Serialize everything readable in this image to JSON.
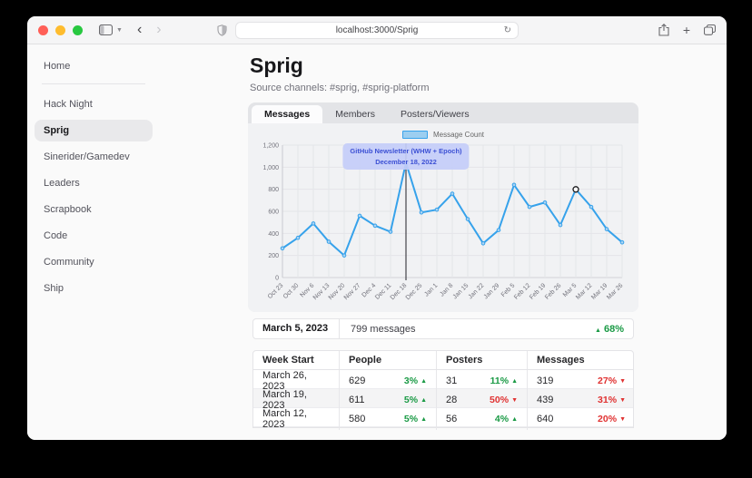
{
  "browser": {
    "url": "localhost:3000/Sprig",
    "traffic_lights": {
      "close": "#ff5f57",
      "minimize": "#febc2e",
      "zoom": "#28c840"
    }
  },
  "sidebar": {
    "items": [
      {
        "label": "Home"
      },
      {
        "label": "Hack Night"
      },
      {
        "label": "Sprig",
        "active": true
      },
      {
        "label": "Sinerider/Gamedev"
      },
      {
        "label": "Leaders"
      },
      {
        "label": "Scrapbook"
      },
      {
        "label": "Code"
      },
      {
        "label": "Community"
      },
      {
        "label": "Ship"
      }
    ]
  },
  "main": {
    "title": "Sprig",
    "subtitle": "Source channels: #sprig, #sprig-platform",
    "tabs": [
      {
        "label": "Messages",
        "active": true
      },
      {
        "label": "Members"
      },
      {
        "label": "Posters/Viewers"
      }
    ]
  },
  "chart_data": {
    "type": "line",
    "legend": "Message Count",
    "categories": [
      "Oct 23",
      "Oct 30",
      "Nov 6",
      "Nov 13",
      "Nov 20",
      "Nov 27",
      "Dec 4",
      "Dec 11",
      "Dec 18",
      "Dec 25",
      "Jan 1",
      "Jan 8",
      "Jan 15",
      "Jan 22",
      "Jan 29",
      "Feb 5",
      "Feb 12",
      "Feb 19",
      "Feb 26",
      "Mar 5",
      "Mar 12",
      "Mar 19",
      "Mar 26"
    ],
    "values": [
      265,
      360,
      490,
      325,
      200,
      560,
      470,
      415,
      1040,
      590,
      615,
      760,
      530,
      310,
      430,
      840,
      640,
      680,
      476,
      799,
      640,
      439,
      319
    ],
    "ylim": [
      0,
      1200
    ],
    "yticks": [
      0,
      200,
      400,
      600,
      800,
      1000,
      1200
    ],
    "line_color": "#36a2eb",
    "grid": true,
    "legend_position": "top",
    "annotation": {
      "index": 8,
      "line1": "GitHub Newsletter (WHW + Epoch)",
      "line2": "December 18, 2022"
    },
    "highlight_index": 19
  },
  "summary": {
    "date": "March 5, 2023",
    "messages": "799 messages",
    "arrow": "▲",
    "change": "68%",
    "dir": "up"
  },
  "table": {
    "headers": [
      "Week Start",
      "People",
      "Posters",
      "Messages"
    ],
    "rows": [
      {
        "week": "March 26, 2023",
        "people": {
          "value": "629",
          "pct": "3%",
          "arrow": "▲",
          "dir": "up"
        },
        "posters": {
          "value": "31",
          "pct": "11%",
          "arrow": "▲",
          "dir": "up"
        },
        "messages": {
          "value": "319",
          "pct": "27%",
          "arrow": "▼",
          "dir": "down"
        }
      },
      {
        "week": "March 19, 2023",
        "people": {
          "value": "611",
          "pct": "5%",
          "arrow": "▲",
          "dir": "up"
        },
        "posters": {
          "value": "28",
          "pct": "50%",
          "arrow": "▼",
          "dir": "down"
        },
        "messages": {
          "value": "439",
          "pct": "31%",
          "arrow": "▼",
          "dir": "down"
        }
      },
      {
        "week": "March 12, 2023",
        "people": {
          "value": "580",
          "pct": "5%",
          "arrow": "▲",
          "dir": "up"
        },
        "posters": {
          "value": "56",
          "pct": "4%",
          "arrow": "▲",
          "dir": "up"
        },
        "messages": {
          "value": "640",
          "pct": "20%",
          "arrow": "▼",
          "dir": "down"
        }
      }
    ]
  },
  "colors": {
    "up": "#1a9a45",
    "down": "#e03131",
    "accent": "#36a2eb"
  }
}
